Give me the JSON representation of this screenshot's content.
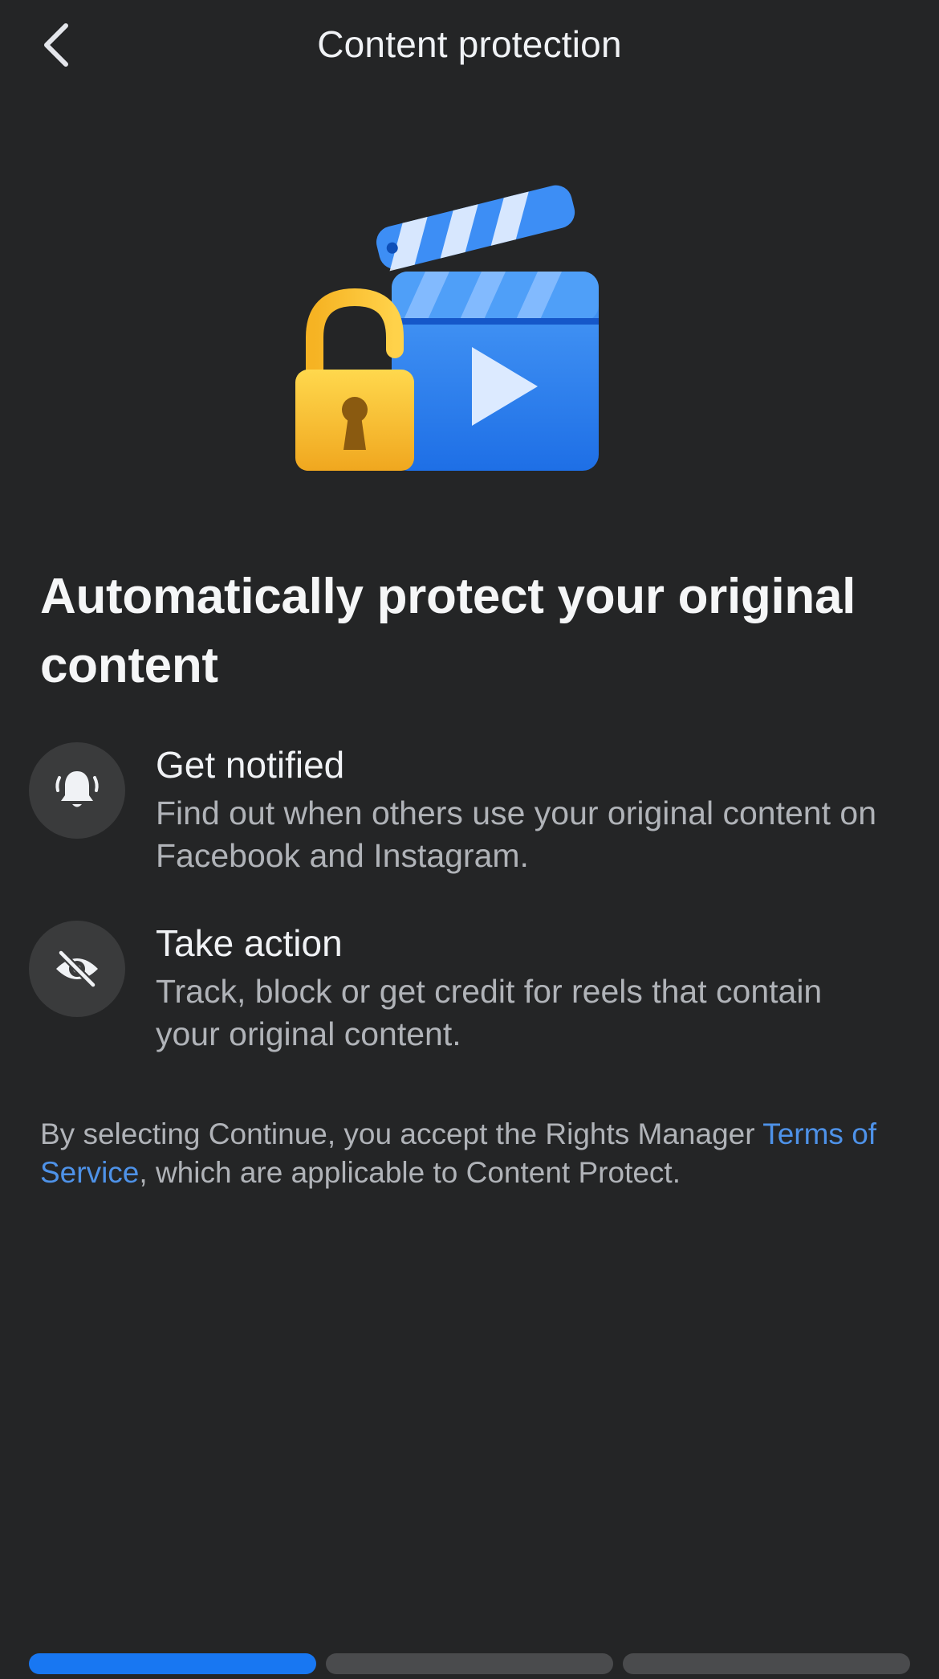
{
  "header": {
    "title": "Content protection",
    "back_icon": "chevron-left-icon"
  },
  "hero": {
    "icon": "clapperboard-lock-icon",
    "colors": {
      "clapper_blue": "#3d8ef5",
      "lock_yellow": "#f7c234"
    }
  },
  "main": {
    "headline": "Automatically protect your original content",
    "features": [
      {
        "icon": "bell-icon",
        "title": "Get notified",
        "description": "Find out when others use your original content on Facebook and Instagram."
      },
      {
        "icon": "eye-slash-icon",
        "title": "Take action",
        "description": "Track, block or get credit for reels that contain your original content."
      }
    ],
    "legal": {
      "prefix": "By selecting Continue, you accept the Rights Manager ",
      "link_text": "Terms of Service",
      "suffix": ", which are applicable to Content Protect."
    }
  },
  "progress": {
    "current_step": 1,
    "total_steps": 3,
    "active_color": "#1877f2",
    "inactive_color": "#4a4b4d"
  }
}
